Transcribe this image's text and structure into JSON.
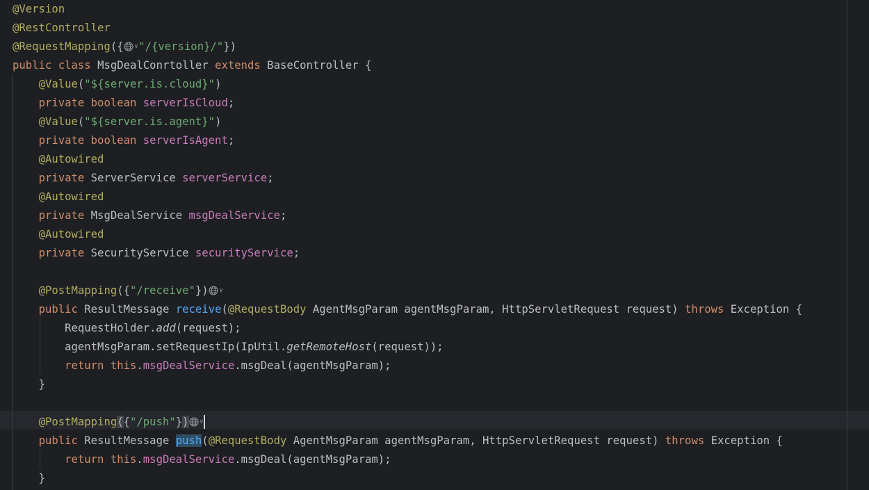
{
  "editor": {
    "lines": [
      [
        {
          "t": "@Version",
          "c": "ann"
        }
      ],
      [
        {
          "t": "@RestController",
          "c": "ann"
        }
      ],
      [
        {
          "t": "@RequestMapping",
          "c": "ann"
        },
        {
          "t": "({"
        },
        {
          "icon": "globe-icon"
        },
        {
          "t": "\"/{version}/\"",
          "c": "str"
        },
        {
          "t": "})"
        }
      ],
      [
        {
          "t": "public",
          "c": "kw"
        },
        {
          "t": " "
        },
        {
          "t": "class",
          "c": "kw"
        },
        {
          "t": " MsgDealConrtoller "
        },
        {
          "t": "extends",
          "c": "kw"
        },
        {
          "t": " BaseController {"
        }
      ],
      [
        {
          "t": "    "
        },
        {
          "t": "@Value",
          "c": "ann"
        },
        {
          "t": "("
        },
        {
          "t": "\"${server.is.cloud}\"",
          "c": "str"
        },
        {
          "t": ")"
        }
      ],
      [
        {
          "t": "    "
        },
        {
          "t": "private",
          "c": "kw"
        },
        {
          "t": " "
        },
        {
          "t": "boolean",
          "c": "kw"
        },
        {
          "t": " "
        },
        {
          "t": "serverIsCloud",
          "c": "fld"
        },
        {
          "t": ";"
        }
      ],
      [
        {
          "t": "    "
        },
        {
          "t": "@Value",
          "c": "ann"
        },
        {
          "t": "("
        },
        {
          "t": "\"${server.is.agent}\"",
          "c": "str"
        },
        {
          "t": ")"
        }
      ],
      [
        {
          "t": "    "
        },
        {
          "t": "private",
          "c": "kw"
        },
        {
          "t": " "
        },
        {
          "t": "boolean",
          "c": "kw"
        },
        {
          "t": " "
        },
        {
          "t": "serverIsAgent",
          "c": "fld"
        },
        {
          "t": ";"
        }
      ],
      [
        {
          "t": "    "
        },
        {
          "t": "@Autowired",
          "c": "ann"
        }
      ],
      [
        {
          "t": "    "
        },
        {
          "t": "private",
          "c": "kw"
        },
        {
          "t": " ServerService "
        },
        {
          "t": "serverService",
          "c": "fld"
        },
        {
          "t": ";"
        }
      ],
      [
        {
          "t": "    "
        },
        {
          "t": "@Autowired",
          "c": "ann"
        }
      ],
      [
        {
          "t": "    "
        },
        {
          "t": "private",
          "c": "kw"
        },
        {
          "t": " MsgDealService "
        },
        {
          "t": "msgDealService",
          "c": "fld"
        },
        {
          "t": ";"
        }
      ],
      [
        {
          "t": "    "
        },
        {
          "t": "@Autowired",
          "c": "ann"
        }
      ],
      [
        {
          "t": "    "
        },
        {
          "t": "private",
          "c": "kw"
        },
        {
          "t": " SecurityService "
        },
        {
          "t": "securityService",
          "c": "fld"
        },
        {
          "t": ";"
        }
      ],
      [],
      [
        {
          "t": "    "
        },
        {
          "t": "@PostMapping",
          "c": "ann"
        },
        {
          "t": "({"
        },
        {
          "t": "\"/receive\"",
          "c": "str"
        },
        {
          "t": "})"
        },
        {
          "icon": "globe-icon"
        }
      ],
      [
        {
          "t": "    "
        },
        {
          "t": "public",
          "c": "kw"
        },
        {
          "t": " ResultMessage "
        },
        {
          "t": "receive",
          "c": "fn"
        },
        {
          "t": "("
        },
        {
          "t": "@RequestBody",
          "c": "ann"
        },
        {
          "t": " AgentMsgParam agentMsgParam, HttpServletRequest request) "
        },
        {
          "t": "throws",
          "c": "kw"
        },
        {
          "t": " Exception {"
        }
      ],
      [
        {
          "t": "        RequestHolder."
        },
        {
          "t": "add",
          "c": "it"
        },
        {
          "t": "(request);"
        }
      ],
      [
        {
          "t": "        agentMsgParam.setRequestIp(IpUtil."
        },
        {
          "t": "getRemoteHost",
          "c": "it"
        },
        {
          "t": "(request));"
        }
      ],
      [
        {
          "t": "        "
        },
        {
          "t": "return",
          "c": "kw"
        },
        {
          "t": " "
        },
        {
          "t": "this",
          "c": "kw"
        },
        {
          "t": "."
        },
        {
          "t": "msgDealService",
          "c": "fld"
        },
        {
          "t": ".msgDeal(agentMsgParam);"
        }
      ],
      [
        {
          "t": "    }"
        }
      ],
      [],
      [
        {
          "t": "    "
        },
        {
          "t": "@PostMapping",
          "c": "ann"
        },
        {
          "t": "(",
          "c": "brmatch"
        },
        {
          "t": "{"
        },
        {
          "t": "\"/push\"",
          "c": "str"
        },
        {
          "t": "}"
        },
        {
          "t": ")",
          "c": "brmatch"
        },
        {
          "icon": "globe-icon"
        },
        {
          "caret": true
        }
      ],
      [
        {
          "t": "    "
        },
        {
          "t": "public",
          "c": "kw"
        },
        {
          "t": " ResultMessage "
        },
        {
          "t": "push",
          "c": "fn hl"
        },
        {
          "t": "("
        },
        {
          "t": "@RequestBody",
          "c": "ann"
        },
        {
          "t": " AgentMsgParam agentMsgParam, HttpServletRequest request) "
        },
        {
          "t": "throws",
          "c": "kw"
        },
        {
          "t": " Exception {"
        }
      ],
      [
        {
          "t": "        "
        },
        {
          "t": "return",
          "c": "kw"
        },
        {
          "t": " "
        },
        {
          "t": "this",
          "c": "kw"
        },
        {
          "t": "."
        },
        {
          "t": "msgDealService",
          "c": "fld"
        },
        {
          "t": ".msgDeal(agentMsgParam);"
        }
      ],
      [
        {
          "t": "    }"
        }
      ]
    ]
  }
}
